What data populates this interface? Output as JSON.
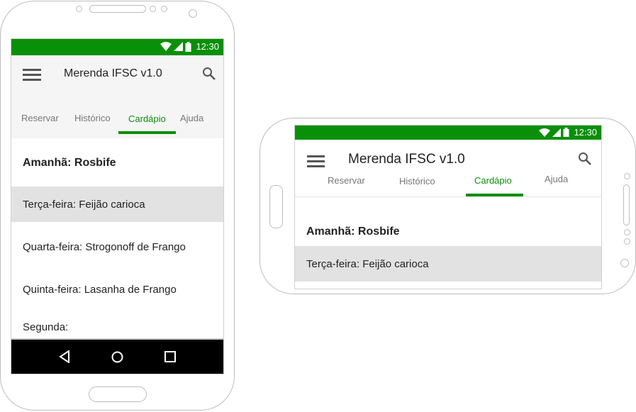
{
  "app": {
    "title": "Merenda IFSC v1.0",
    "status_time": "12:30",
    "brand_color": "#0a8f08"
  },
  "icons": {
    "menu": "hamburger-menu-icon",
    "search": "search-icon",
    "wifi": "wifi-icon",
    "signal": "signal-icon",
    "battery": "battery-icon",
    "back": "back-triangle-icon",
    "home": "home-circle-icon",
    "recents": "recents-square-icon"
  },
  "tabs": [
    {
      "label": "Reservar",
      "active": false
    },
    {
      "label": "Histórico",
      "active": false
    },
    {
      "label": "Cardápio",
      "active": true
    },
    {
      "label": "Ajuda",
      "active": false
    }
  ],
  "menu_items": [
    {
      "label": "Amanhã: Rosbife",
      "bold": true
    },
    {
      "label": "Terça-feira: Feijão carioca",
      "highlighted": true
    },
    {
      "label": "Quarta-feira: Strogonoff de Frango"
    },
    {
      "label": "Quinta-feira: Lasanha de Frango"
    },
    {
      "label": "Segunda:"
    }
  ]
}
